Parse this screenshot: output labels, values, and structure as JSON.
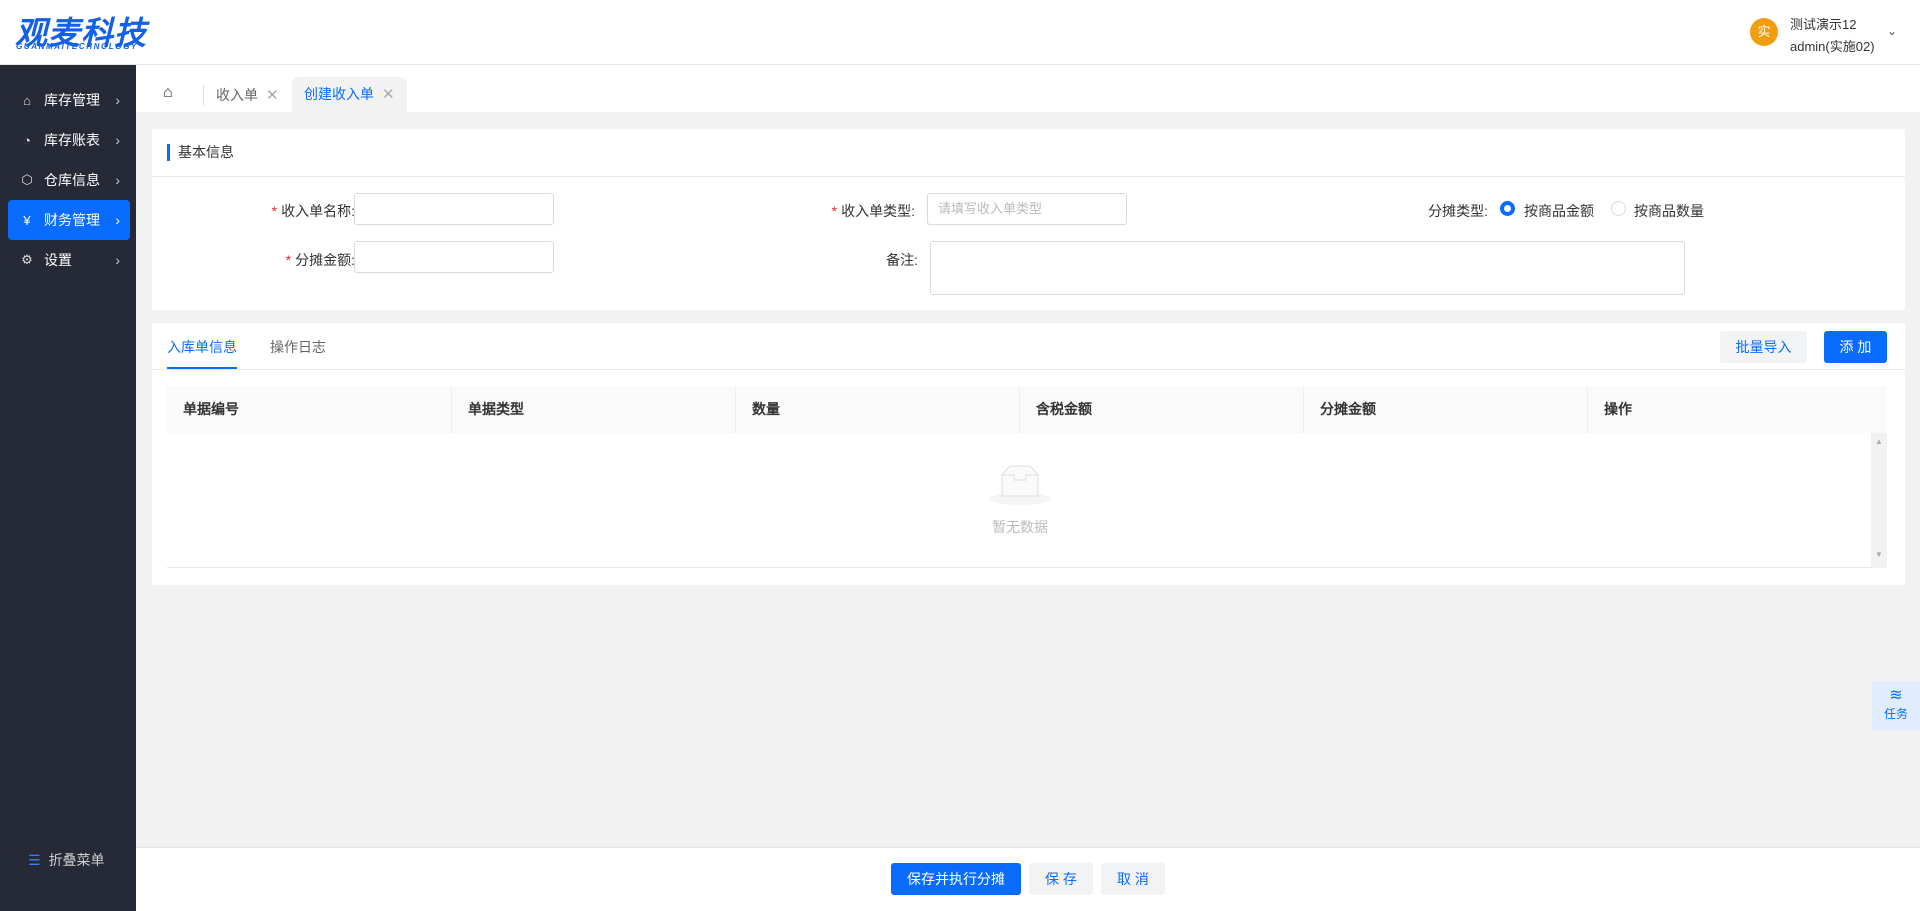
{
  "header": {
    "logo": "观麦科技",
    "logo_sub": "GUANMAITECHNOLOGY",
    "avatar": "实",
    "user_name": "测试演示12",
    "user_account": "admin(实施02)"
  },
  "sidebar": {
    "items": [
      {
        "label": "库存管理",
        "icon": "home-building-icon"
      },
      {
        "label": "库存账表",
        "icon": "pie-chart-icon"
      },
      {
        "label": "仓库信息",
        "icon": "cube-icon"
      },
      {
        "label": "财务管理",
        "icon": "wallet-icon",
        "active": true
      },
      {
        "label": "设置",
        "icon": "gear-icon"
      }
    ],
    "collapse": "折叠菜单"
  },
  "tabs": [
    {
      "label": "收入单"
    },
    {
      "label": "创建收入单",
      "active": true
    }
  ],
  "basic": {
    "title": "基本信息",
    "name_label": "收入单名称:",
    "name_value": "",
    "type_label": "收入单类型:",
    "type_placeholder": "请填写收入单类型",
    "alloc_type_label": "分摊类型:",
    "alloc_options": [
      "按商品金额",
      "按商品数量"
    ],
    "alloc_selected": "按商品金额",
    "amount_label": "分摊金额:",
    "amount_value": "",
    "remark_label": "备注:",
    "remark_value": ""
  },
  "detail": {
    "tabs": [
      "入库单信息",
      "操作日志"
    ],
    "active_tab": "入库单信息",
    "import_label": "批量导入",
    "add_label": "添 加",
    "columns": [
      "单据编号",
      "单据类型",
      "数量",
      "含税金额",
      "分摊金额",
      "操作"
    ],
    "empty": "暂无数据"
  },
  "footer": {
    "save_exec": "保存并执行分摊",
    "save": "保 存",
    "cancel": "取 消"
  },
  "task": "任务",
  "colors": {
    "primary": "#0a6cff",
    "sidebar": "#262a36",
    "avatar": "#f29d0f"
  }
}
